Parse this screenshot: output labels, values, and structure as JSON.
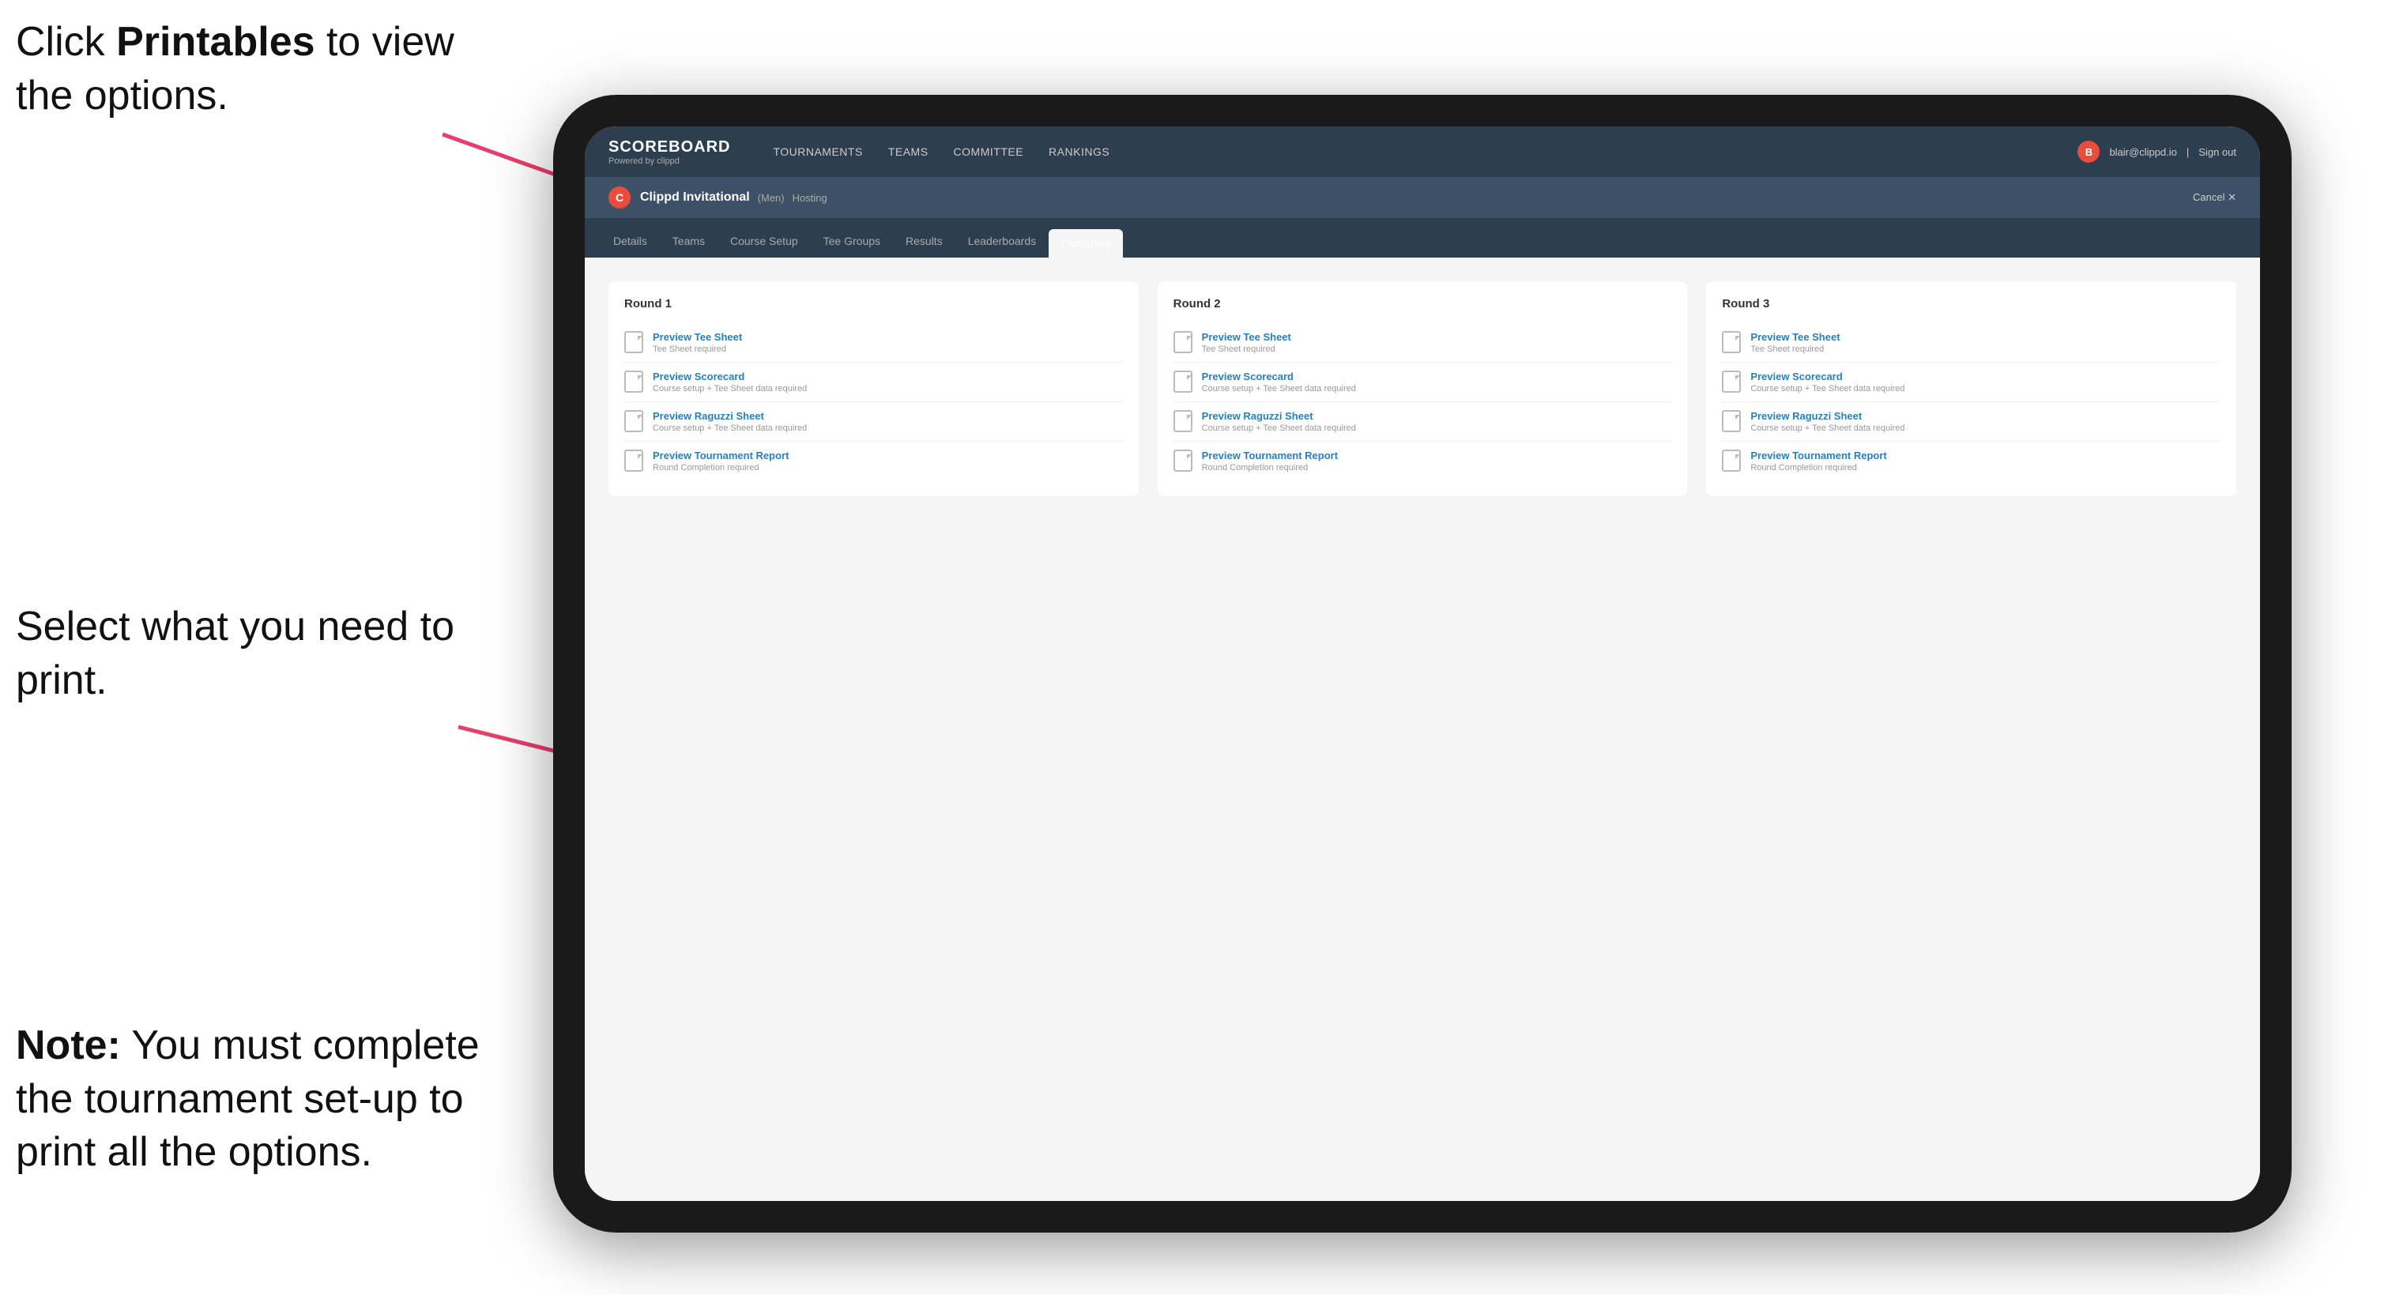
{
  "annotations": {
    "top": {
      "line1": "Click ",
      "bold": "Printables",
      "line2": " to",
      "line3": "view the options."
    },
    "middle": {
      "line1": "Select what you",
      "line2": "need to print."
    },
    "bottom": {
      "bold": "Note:",
      "text": " You must complete the tournament set-up to print all the options."
    }
  },
  "nav": {
    "brand": "SCOREBOARD",
    "brand_sub": "Powered by clippd",
    "links": [
      "TOURNAMENTS",
      "TEAMS",
      "COMMITTEE",
      "RANKINGS"
    ],
    "user_email": "blair@clippd.io",
    "sign_out": "Sign out"
  },
  "sub_nav": {
    "tournament_name": "Clippd Invitational",
    "category": "(Men)",
    "status": "Hosting",
    "cancel": "Cancel ✕"
  },
  "tabs": [
    "Details",
    "Teams",
    "Course Setup",
    "Tee Groups",
    "Results",
    "Leaderboards",
    "Printables"
  ],
  "active_tab": "Printables",
  "rounds": [
    {
      "label": "Round 1",
      "items": [
        {
          "title": "Preview Tee Sheet",
          "subtitle": "Tee Sheet required"
        },
        {
          "title": "Preview Scorecard",
          "subtitle": "Course setup + Tee Sheet data required"
        },
        {
          "title": "Preview Raguzzi Sheet",
          "subtitle": "Course setup + Tee Sheet data required"
        },
        {
          "title": "Preview Tournament Report",
          "subtitle": "Round Completion required"
        }
      ]
    },
    {
      "label": "Round 2",
      "items": [
        {
          "title": "Preview Tee Sheet",
          "subtitle": "Tee Sheet required"
        },
        {
          "title": "Preview Scorecard",
          "subtitle": "Course setup + Tee Sheet data required"
        },
        {
          "title": "Preview Raguzzi Sheet",
          "subtitle": "Course setup + Tee Sheet data required"
        },
        {
          "title": "Preview Tournament Report",
          "subtitle": "Round Completion required"
        }
      ]
    },
    {
      "label": "Round 3",
      "items": [
        {
          "title": "Preview Tee Sheet",
          "subtitle": "Tee Sheet required"
        },
        {
          "title": "Preview Scorecard",
          "subtitle": "Course setup + Tee Sheet data required"
        },
        {
          "title": "Preview Raguzzi Sheet",
          "subtitle": "Course setup + Tee Sheet data required"
        },
        {
          "title": "Preview Tournament Report",
          "subtitle": "Round Completion required"
        }
      ]
    }
  ]
}
